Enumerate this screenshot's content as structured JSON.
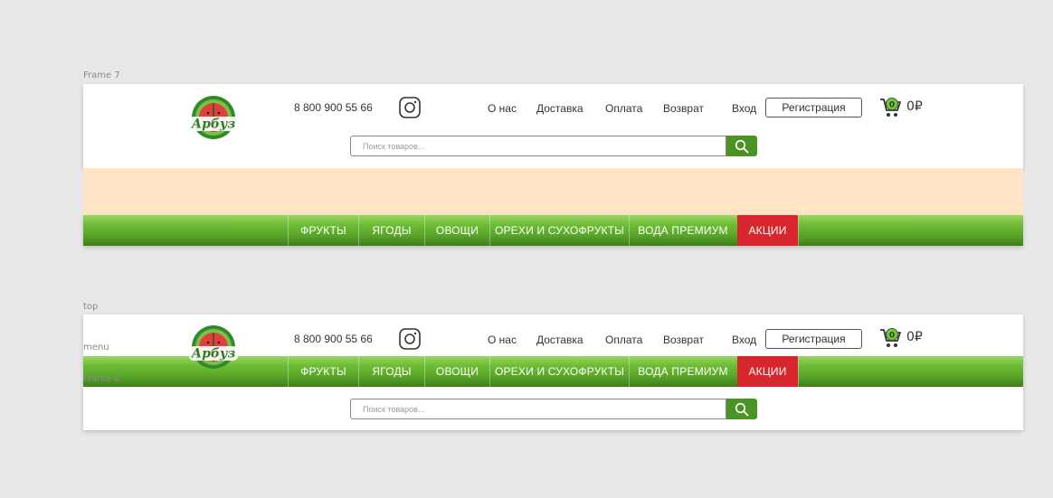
{
  "frames": {
    "frame7": "Frame 7",
    "top": "top",
    "menu": "menu",
    "frame6": "Frame 6"
  },
  "header": {
    "logo_text": "Арбуз",
    "phone": "8 800 900 55 66",
    "nav": [
      "О нас",
      "Доставка",
      "Оплата",
      "Возврат"
    ],
    "login": "Вход",
    "register": "Регистрация",
    "cart_count": "0",
    "cart_sum": "0₽"
  },
  "search": {
    "placeholder": "Поиск товаров..."
  },
  "menu": {
    "items": [
      "ФРУКТЫ",
      "ЯГОДЫ",
      "ОВОЩИ",
      "ОРЕХИ И СУХОФРУКТЫ",
      "ВОДА ПРЕМИУМ",
      "АКЦИИ"
    ]
  },
  "colors": {
    "accent_green": "#5aa62a",
    "sale_red": "#d7262d",
    "banner_peach": "#ffe5c5"
  },
  "icons": [
    "logo-icon",
    "instagram-icon",
    "cart-icon",
    "search-icon"
  ]
}
